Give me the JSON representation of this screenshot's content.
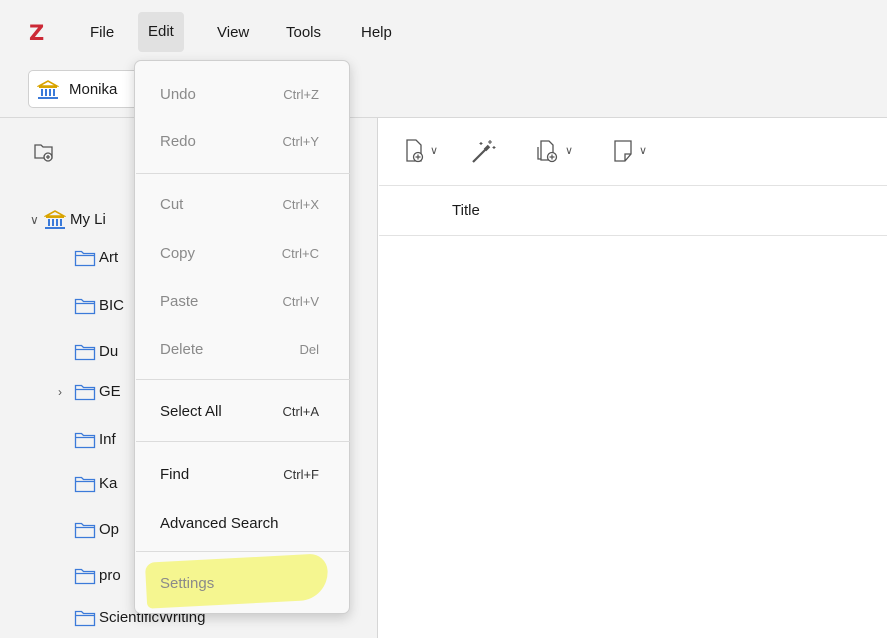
{
  "app": {
    "logo": "Z"
  },
  "menubar": {
    "file": "File",
    "edit": "Edit",
    "view": "View",
    "tools": "Tools",
    "help": "Help"
  },
  "library_tab": {
    "label": "Monika",
    "icon": "bank-icon"
  },
  "left_pane": {
    "root": {
      "label": "My Li",
      "icon": "bank-icon",
      "expanded": true
    },
    "collections": [
      {
        "label": "Art"
      },
      {
        "label": "BIC"
      },
      {
        "label": "Du"
      },
      {
        "label": "GE",
        "collapsed_twisty": true
      },
      {
        "label": "Inf"
      },
      {
        "label": "Ka"
      },
      {
        "label": "Op"
      },
      {
        "label": "pro"
      },
      {
        "label": "ScientificWriting"
      }
    ]
  },
  "items_pane": {
    "column_title": "Title",
    "tool_icons": [
      "new-item-icon",
      "magic-wand-icon",
      "add-attachment-icon",
      "new-note-icon"
    ]
  },
  "edit_menu": {
    "items": [
      {
        "label": "Undo",
        "shortcut": "Ctrl+Z",
        "disabled": true
      },
      {
        "label": "Redo",
        "shortcut": "Ctrl+Y",
        "disabled": true
      },
      {
        "label": "Cut",
        "shortcut": "Ctrl+X",
        "disabled": true
      },
      {
        "label": "Copy",
        "shortcut": "Ctrl+C",
        "disabled": true
      },
      {
        "label": "Paste",
        "shortcut": "Ctrl+V",
        "disabled": true
      },
      {
        "label": "Delete",
        "shortcut": "Del",
        "disabled": true
      },
      {
        "label": "Select All",
        "shortcut": "Ctrl+A",
        "disabled": false
      },
      {
        "label": "Find",
        "shortcut": "Ctrl+F",
        "disabled": false
      },
      {
        "label": "Advanced Search",
        "shortcut": "",
        "disabled": false
      },
      {
        "label": "Settings",
        "shortcut": "",
        "disabled": true,
        "highlighted": true
      }
    ]
  },
  "colors": {
    "brand": "#cc2936",
    "highlight": "#f4f584",
    "chrome": "#f3f3f3"
  }
}
